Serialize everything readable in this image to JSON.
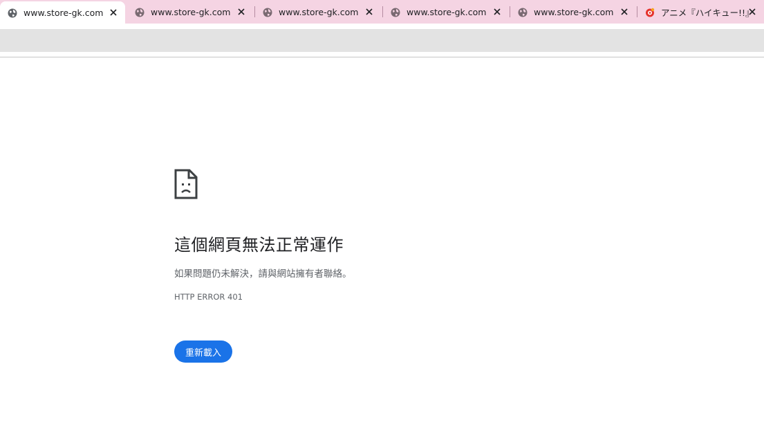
{
  "tabs": [
    {
      "title": "www.store-gk.com",
      "icon": "globe-icon",
      "active": true
    },
    {
      "title": "www.store-gk.com",
      "icon": "globe-icon",
      "active": false
    },
    {
      "title": "www.store-gk.com",
      "icon": "globe-icon",
      "active": false
    },
    {
      "title": "www.store-gk.com",
      "icon": "globe-icon",
      "active": false
    },
    {
      "title": "www.store-gk.com",
      "icon": "globe-icon",
      "active": false
    },
    {
      "title": "アニメ『ハイキュー!!』×極",
      "icon": "site-logo-icon",
      "active": false
    }
  ],
  "colors": {
    "tabstrip": "#f5d4e3",
    "accent": "#1a73e8",
    "headline": "#202124",
    "secondary_text": "#5f6368"
  },
  "error_page": {
    "icon": "sad-document-icon",
    "headline": "這個網頁無法正常運作",
    "message": "如果問題仍未解決，請與網站擁有者聯絡。",
    "error_code": "HTTP ERROR 401",
    "reload_label": "重新載入"
  }
}
